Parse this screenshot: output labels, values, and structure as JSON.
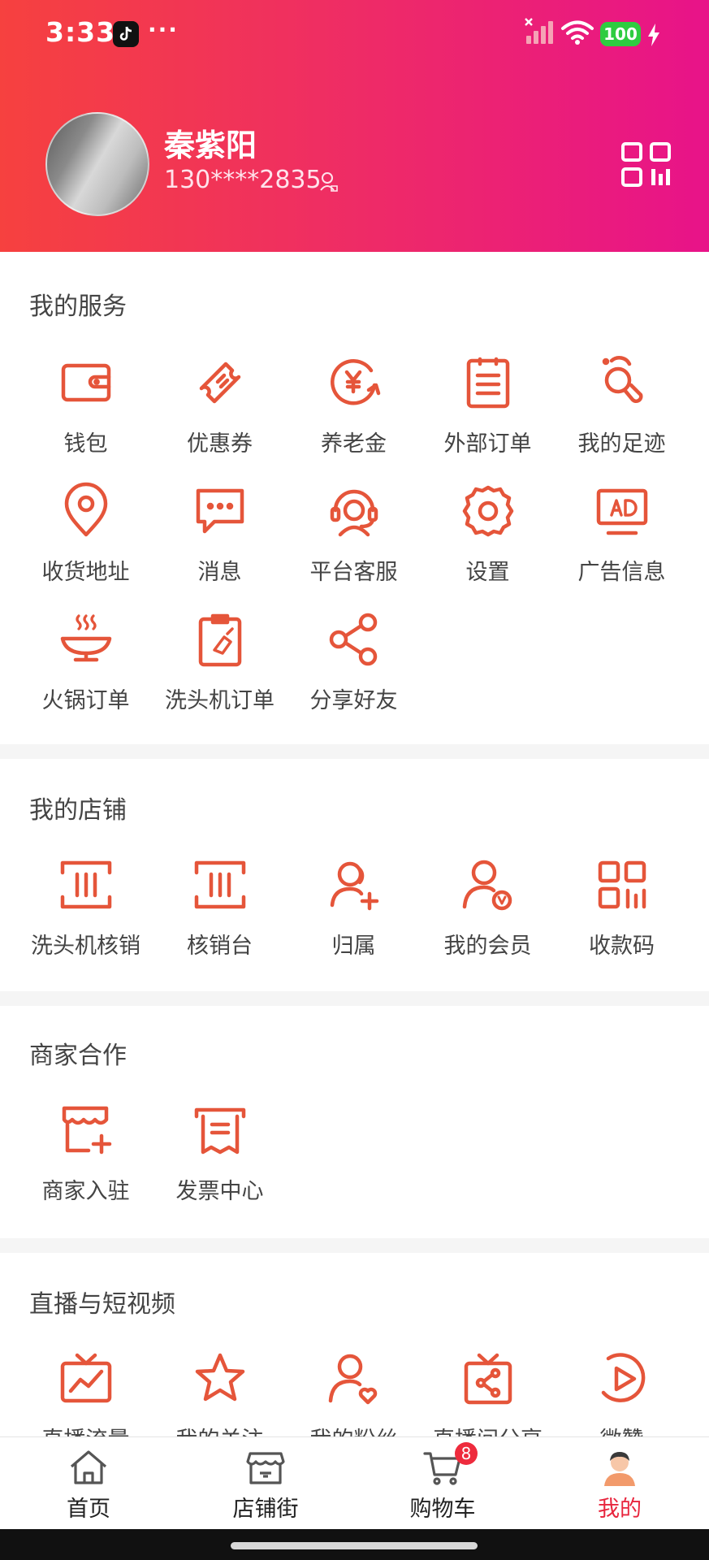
{
  "status_bar": {
    "time": "3:33",
    "dots": "···",
    "battery": "100"
  },
  "profile": {
    "name": "秦紫阳",
    "phone": "130****2835"
  },
  "colors": {
    "accent": "#e5553a",
    "header_gradient_start": "#f6413f",
    "header_gradient_end": "#e81389",
    "active_tab": "#e8253d",
    "badge": "#ee2b3d"
  },
  "sections": {
    "services": {
      "title": "我的服务",
      "items": [
        {
          "label": "钱包",
          "icon": "wallet-icon"
        },
        {
          "label": "优惠券",
          "icon": "coupon-icon"
        },
        {
          "label": "养老金",
          "icon": "pension-icon"
        },
        {
          "label": "外部订单",
          "icon": "order-list-icon"
        },
        {
          "label": "我的足迹",
          "icon": "footprint-icon"
        },
        {
          "label": "收货地址",
          "icon": "location-pin-icon"
        },
        {
          "label": "消息",
          "icon": "message-icon"
        },
        {
          "label": "平台客服",
          "icon": "customer-service-icon"
        },
        {
          "label": "设置",
          "icon": "gear-icon"
        },
        {
          "label": "广告信息",
          "icon": "ad-icon"
        },
        {
          "label": "火锅订单",
          "icon": "hotpot-icon"
        },
        {
          "label": "洗头机订单",
          "icon": "clipboard-order-icon"
        },
        {
          "label": "分享好友",
          "icon": "share-icon"
        }
      ]
    },
    "shop": {
      "title": "我的店铺",
      "items": [
        {
          "label": "洗头机核销",
          "icon": "scan-icon"
        },
        {
          "label": "核销台",
          "icon": "scan-icon"
        },
        {
          "label": "归属",
          "icon": "add-user-icon"
        },
        {
          "label": "我的会员",
          "icon": "member-icon"
        },
        {
          "label": "收款码",
          "icon": "qr-code-icon"
        }
      ]
    },
    "merchant": {
      "title": "商家合作",
      "items": [
        {
          "label": "商家入驻",
          "icon": "store-join-icon"
        },
        {
          "label": "发票中心",
          "icon": "invoice-icon"
        }
      ]
    },
    "live": {
      "title": "直播与短视频",
      "items": [
        {
          "label": "直播流量",
          "icon": "tv-chart-icon"
        },
        {
          "label": "我的关注",
          "icon": "star-icon"
        },
        {
          "label": "我的粉丝",
          "icon": "fans-icon"
        },
        {
          "label": "直播间分享",
          "icon": "tv-share-icon"
        },
        {
          "label": "微赞",
          "icon": "play-icon"
        }
      ]
    }
  },
  "bottom_nav": {
    "items": [
      {
        "label": "首页",
        "icon": "home-icon"
      },
      {
        "label": "店铺街",
        "icon": "shop-street-icon"
      },
      {
        "label": "购物车",
        "icon": "cart-icon",
        "badge": "8"
      },
      {
        "label": "我的",
        "icon": "profile-icon",
        "active": true
      }
    ]
  }
}
